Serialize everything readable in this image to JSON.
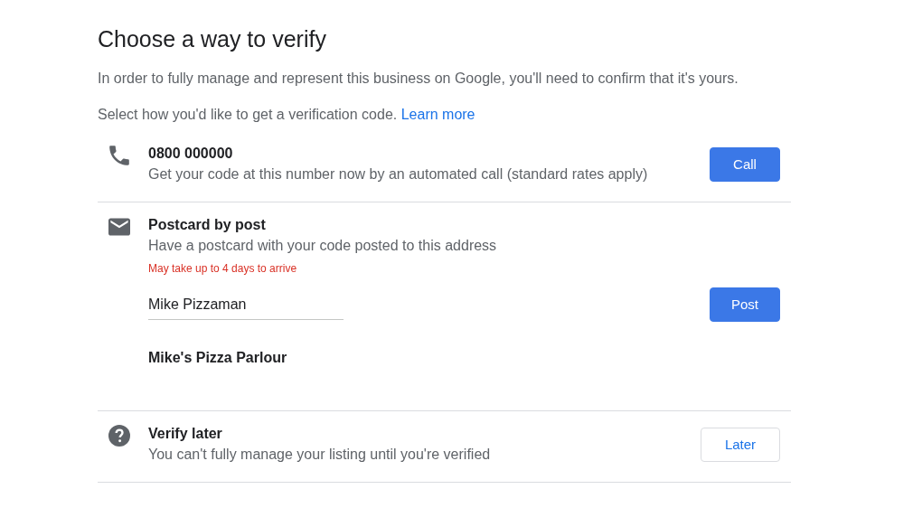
{
  "title": "Choose a way to verify",
  "intro": "In order to fully manage and represent this business on Google, you'll need to confirm that it's yours.",
  "select_text": "Select how you'd like to get a verification code.",
  "learn_more": "Learn more",
  "options": [
    {
      "kind": "phone",
      "title": "0800 000000",
      "description": "Get your code at this number now by an automated call (standard rates apply)",
      "button": {
        "label": "Call"
      }
    },
    {
      "kind": "postcard",
      "title": "Postcard by post",
      "description": "Have a postcard with your code posted to this address",
      "note": "May take up to 4 days to arrive",
      "name_field": {
        "value": "Mike Pizzaman"
      },
      "business_name": "Mike's Pizza Parlour",
      "button": {
        "label": "Post"
      }
    },
    {
      "kind": "later",
      "title": "Verify later",
      "description": "You can't fully manage your listing until you're verified",
      "button": {
        "label": "Later"
      }
    }
  ]
}
